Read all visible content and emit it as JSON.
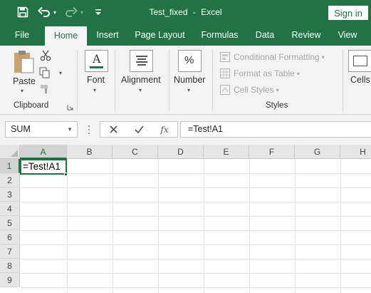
{
  "window": {
    "file_name": "Test_fixed",
    "separator": "-",
    "app_name": "Excel",
    "sign_in": "Sign in"
  },
  "tabs": [
    {
      "label": "File",
      "active": false
    },
    {
      "label": "Home",
      "active": true
    },
    {
      "label": "Insert",
      "active": false
    },
    {
      "label": "Page Layout",
      "active": false
    },
    {
      "label": "Formulas",
      "active": false
    },
    {
      "label": "Data",
      "active": false
    },
    {
      "label": "Review",
      "active": false
    },
    {
      "label": "View",
      "active": false
    }
  ],
  "ribbon": {
    "clipboard": {
      "paste": "Paste",
      "group_label": "Clipboard"
    },
    "font": {
      "label": "Font"
    },
    "alignment": {
      "label": "Alignment"
    },
    "number": {
      "label": "Number"
    },
    "styles": {
      "conditional_formatting": "Conditional Formatting",
      "format_as_table": "Format as Table",
      "cell_styles": "Cell Styles",
      "group_label": "Styles"
    },
    "cells": {
      "label": "Cells"
    }
  },
  "formula_bar": {
    "name_box": "SUM",
    "formula": "=Test!A1",
    "fx": "fx"
  },
  "sheet": {
    "columns": [
      "A",
      "B",
      "C",
      "D",
      "E",
      "F",
      "G",
      "H"
    ],
    "rows": [
      "1",
      "2",
      "3",
      "4",
      "5",
      "6",
      "7",
      "8",
      "9"
    ],
    "active_cell": "A1",
    "active_cell_content": "=Test!A1"
  },
  "colors": {
    "brand": "#217346",
    "ribbon_bg": "#f3f3f3"
  }
}
